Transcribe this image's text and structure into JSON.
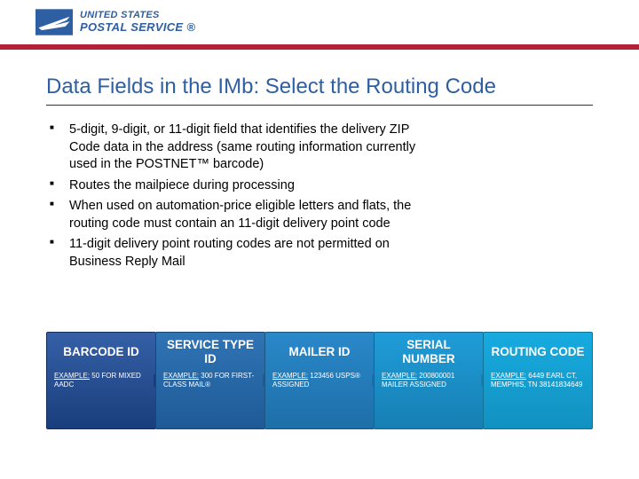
{
  "header": {
    "brand_line1": "UNITED STATES",
    "brand_line2": "POSTAL SERVICE ®"
  },
  "title": "Data Fields in the IMb: Select the Routing Code",
  "bullets": [
    "5-digit, 9-digit, or 11-digit field that identifies the delivery ZIP Code data in the address (same routing information currently used in the POSTNET™ barcode)",
    "Routes the mailpiece during processing",
    "When used on automation-price eligible letters and flats, the routing code must contain an 11-digit delivery point code",
    "11-digit delivery point routing codes are not permitted on Business Reply Mail"
  ],
  "boxes": [
    {
      "title": "BARCODE ID",
      "example_label": "EXAMPLE:",
      "example_text": " 50 FOR MIXED AADC"
    },
    {
      "title": "SERVICE TYPE ID",
      "example_label": "EXAMPLE:",
      "example_text": " 300 FOR FIRST-CLASS MAIL®"
    },
    {
      "title": "MAILER ID",
      "example_label": "EXAMPLE:",
      "example_text": " 123456 USPS® ASSIGNED"
    },
    {
      "title": "SERIAL NUMBER",
      "example_label": "EXAMPLE:",
      "example_text": " 200800001 MAILER ASSIGNED"
    },
    {
      "title": "ROUTING CODE",
      "example_label": "EXAMPLE:",
      "example_text": " 6449 EARL CT, MEMPHIS, TN 38141834649"
    }
  ]
}
